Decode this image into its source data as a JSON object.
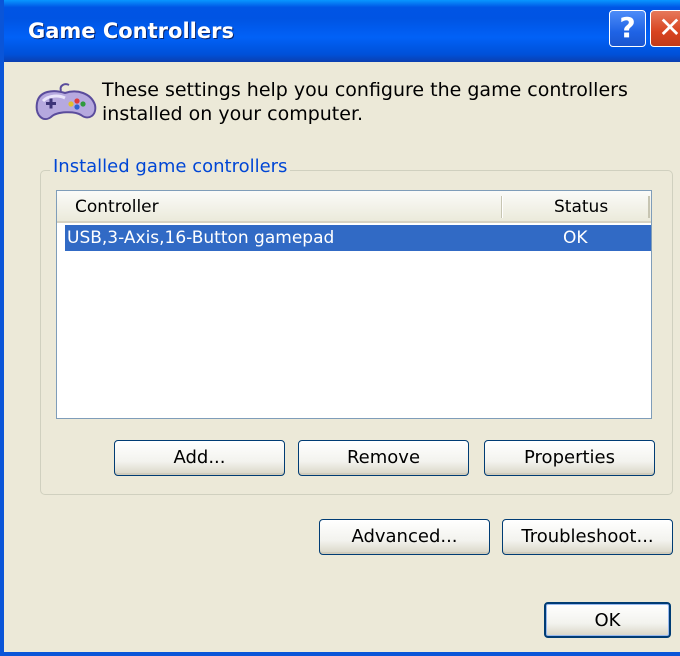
{
  "window": {
    "title": "Game Controllers",
    "help_button": "?",
    "close_button": "✕"
  },
  "intro": {
    "icon": "gamepad-icon",
    "text": "These settings help you configure the game controllers installed on your computer."
  },
  "group": {
    "label": "Installed game controllers",
    "list": {
      "columns": [
        "Controller",
        "Status"
      ],
      "rows": [
        {
          "controller": "USB,3-Axis,16-Button gamepad",
          "status": "OK",
          "selected": true
        }
      ]
    },
    "buttons": {
      "add": "Add...",
      "remove": "Remove",
      "properties": "Properties"
    }
  },
  "buttons": {
    "advanced": "Advanced...",
    "troubleshoot": "Troubleshoot...",
    "ok": "OK"
  },
  "colors": {
    "titlebar": "#0054e3",
    "dialog_bg": "#ece9d8",
    "selection": "#316ac5",
    "group_label": "#0046d5"
  }
}
